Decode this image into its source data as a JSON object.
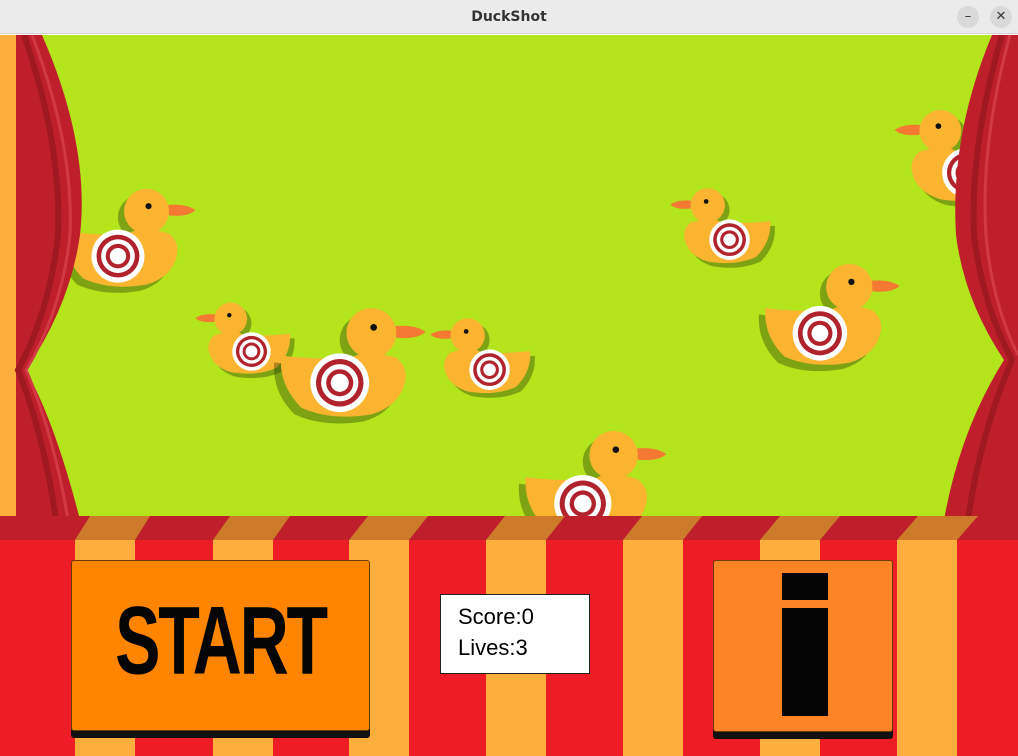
{
  "window": {
    "title": "DuckShot",
    "minimize_glyph": "–",
    "close_glyph": "✕"
  },
  "game": {
    "start_label": "START",
    "info_icon": "info-i-icon",
    "score_label": "Score:",
    "score": 0,
    "lives_label": "Lives:",
    "lives": 3
  },
  "colors": {
    "field": "#b3e41c",
    "curtain": "#bf1f2b",
    "stripe_red": "#ee1c25",
    "stripe_orange": "#fdaf3d",
    "start_button": "#ff8400",
    "info_button": "#ff8426",
    "duck_body": "#fbb430",
    "duck_beak": "#f47a34",
    "target_red": "#b1232c"
  }
}
